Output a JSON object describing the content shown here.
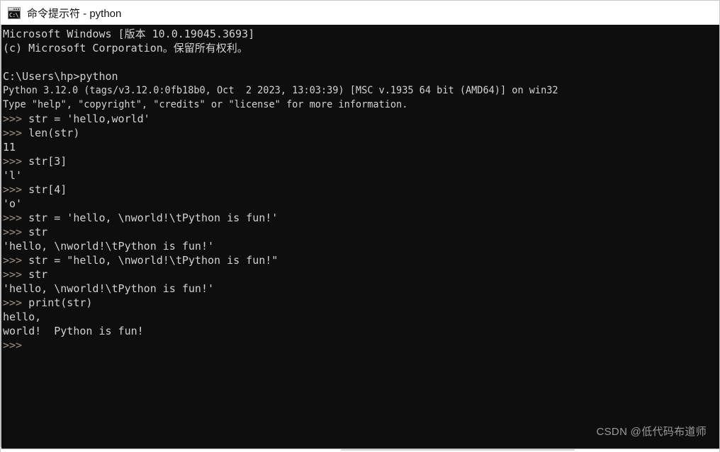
{
  "window": {
    "title": "命令提示符 - python",
    "icon": "cmd-console-icon",
    "icon_glyph": "C:\\_",
    "background": "#0e0e0e",
    "text_color": "#cdcdcd",
    "prompt_color": "#9c9284",
    "titlebar_color": "#ffffff"
  },
  "console": {
    "lines": [
      {
        "id": "line-0",
        "type": "output",
        "text": "Microsoft Windows [版本 10.0.19045.3693]"
      },
      {
        "id": "line-1",
        "type": "output",
        "text": "(c) Microsoft Corporation。保留所有权利。"
      },
      {
        "id": "line-2",
        "type": "blank",
        "text": ""
      },
      {
        "id": "line-3",
        "type": "command",
        "text": "C:\\Users\\hp>python"
      },
      {
        "id": "line-4",
        "type": "output",
        "text": "Python 3.12.0 (tags/v3.12.0:0fb18b0, Oct  2 2023, 13:03:39) [MSC v.1935 64 bit (AMD64)] on win32"
      },
      {
        "id": "line-5",
        "type": "output",
        "text": "Type \"help\", \"copyright\", \"credits\" or \"license\" for more information."
      },
      {
        "id": "line-6",
        "type": "input",
        "prompt": ">>> ",
        "text": "str = 'hello,world'"
      },
      {
        "id": "line-7",
        "type": "input",
        "prompt": ">>> ",
        "text": "len(str)"
      },
      {
        "id": "line-8",
        "type": "output",
        "text": "11"
      },
      {
        "id": "line-9",
        "type": "input",
        "prompt": ">>> ",
        "text": "str[3]"
      },
      {
        "id": "line-10",
        "type": "output",
        "text": "'l'"
      },
      {
        "id": "line-11",
        "type": "input",
        "prompt": ">>> ",
        "text": "str[4]"
      },
      {
        "id": "line-12",
        "type": "output",
        "text": "'o'"
      },
      {
        "id": "line-13",
        "type": "input",
        "prompt": ">>> ",
        "text": "str = 'hello, \\nworld!\\tPython is fun!'"
      },
      {
        "id": "line-14",
        "type": "input",
        "prompt": ">>> ",
        "text": "str"
      },
      {
        "id": "line-15",
        "type": "output",
        "text": "'hello, \\nworld!\\tPython is fun!'"
      },
      {
        "id": "line-16",
        "type": "input",
        "prompt": ">>> ",
        "text": "str = \"hello, \\nworld!\\tPython is fun!\""
      },
      {
        "id": "line-17",
        "type": "input",
        "prompt": ">>> ",
        "text": "str"
      },
      {
        "id": "line-18",
        "type": "output",
        "text": "'hello, \\nworld!\\tPython is fun!'"
      },
      {
        "id": "line-19",
        "type": "input",
        "prompt": ">>> ",
        "text": "print(str)"
      },
      {
        "id": "line-20",
        "type": "output",
        "text": "hello,"
      },
      {
        "id": "line-21",
        "type": "output",
        "text": "world!  Python is fun!"
      },
      {
        "id": "line-22",
        "type": "input",
        "prompt": ">>> ",
        "text": ""
      }
    ]
  },
  "watermark": {
    "text": "CSDN @低代码布道师"
  }
}
